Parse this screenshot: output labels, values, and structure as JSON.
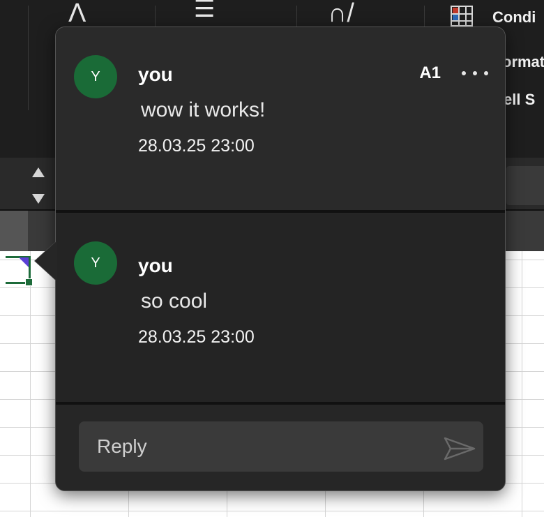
{
  "ribbon": {
    "conditional_label": "Condi",
    "format_label": "ormat",
    "cell_styles_label": "ell S"
  },
  "comment_popover": {
    "cell_ref": "A1",
    "more_icon": "ellipsis-icon",
    "threads": [
      {
        "avatar_initial": "Y",
        "author": "you",
        "text": "wow it works!",
        "timestamp": "28.03.25 23:00"
      },
      {
        "avatar_initial": "Y",
        "author": "you",
        "text": "so cool",
        "timestamp": "28.03.25 23:00"
      }
    ],
    "reply": {
      "placeholder": "Reply",
      "value": "",
      "send_icon": "send-icon"
    },
    "colors": {
      "avatar": "#1a6b37",
      "panel": "#262626",
      "accent_marker": "#5b3fd6"
    }
  }
}
